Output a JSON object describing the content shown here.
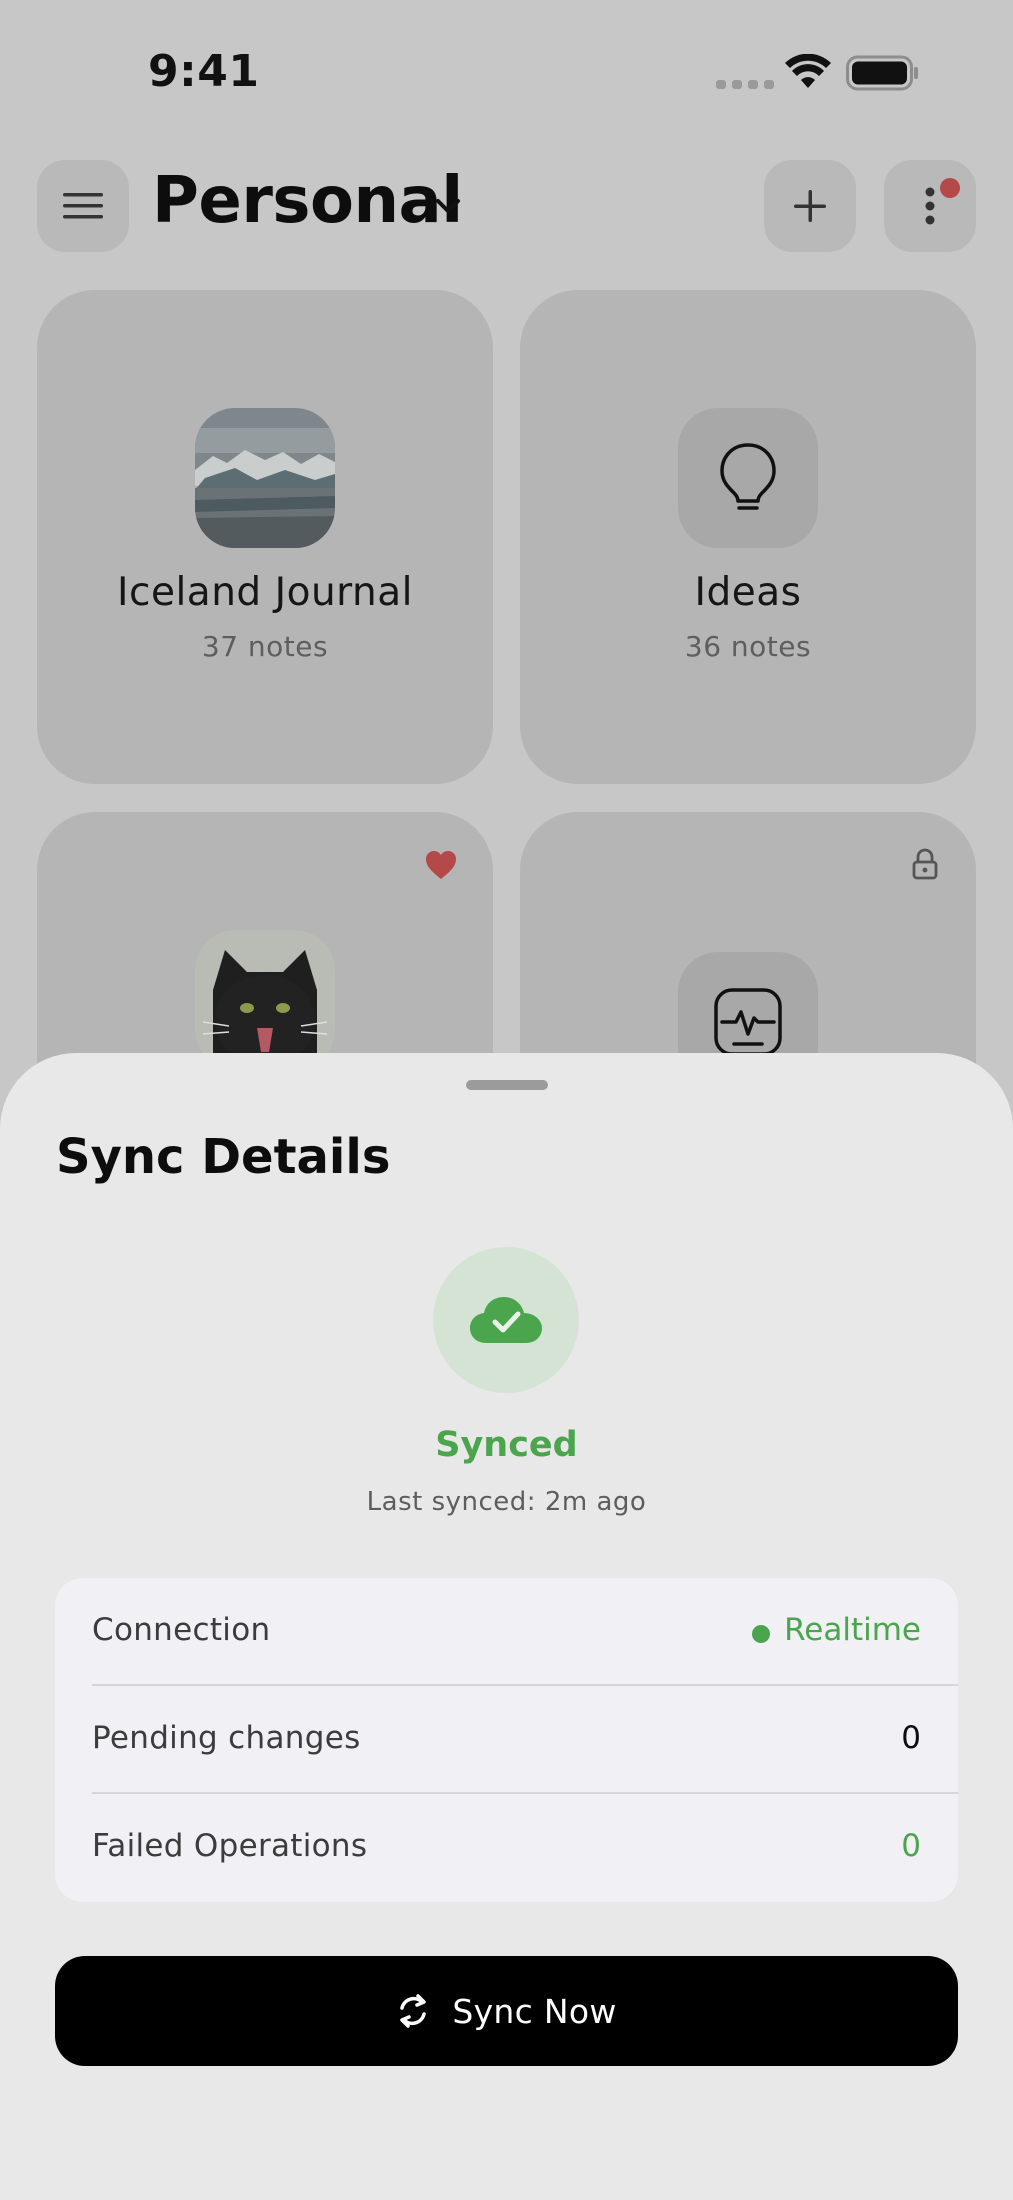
{
  "status_bar": {
    "time": "9:41"
  },
  "header": {
    "title": "Personal"
  },
  "notebooks": [
    {
      "title": "Iceland Journal",
      "subtitle": "37 notes",
      "thumb": "glacier-photo"
    },
    {
      "title": "Ideas",
      "subtitle": "36 notes",
      "thumb": "lightbulb-icon"
    },
    {
      "title": "",
      "subtitle": "",
      "thumb": "cat-photo",
      "favorite": true
    },
    {
      "title": "",
      "subtitle": "",
      "thumb": "activity-icon",
      "locked": true
    }
  ],
  "sheet": {
    "title": "Sync Details",
    "status": "Synced",
    "last_synced": "Last synced: 2m ago",
    "rows": [
      {
        "label": "Connection",
        "value": "Realtime"
      },
      {
        "label": "Pending changes",
        "value": "0"
      },
      {
        "label": "Failed Operations",
        "value": "0"
      }
    ],
    "button_label": "Sync Now"
  },
  "colors": {
    "accent_green": "#4aa54d",
    "favorite_red": "#b54848",
    "sheet_bg": "#e8e8e8",
    "button_bg": "#000000"
  }
}
